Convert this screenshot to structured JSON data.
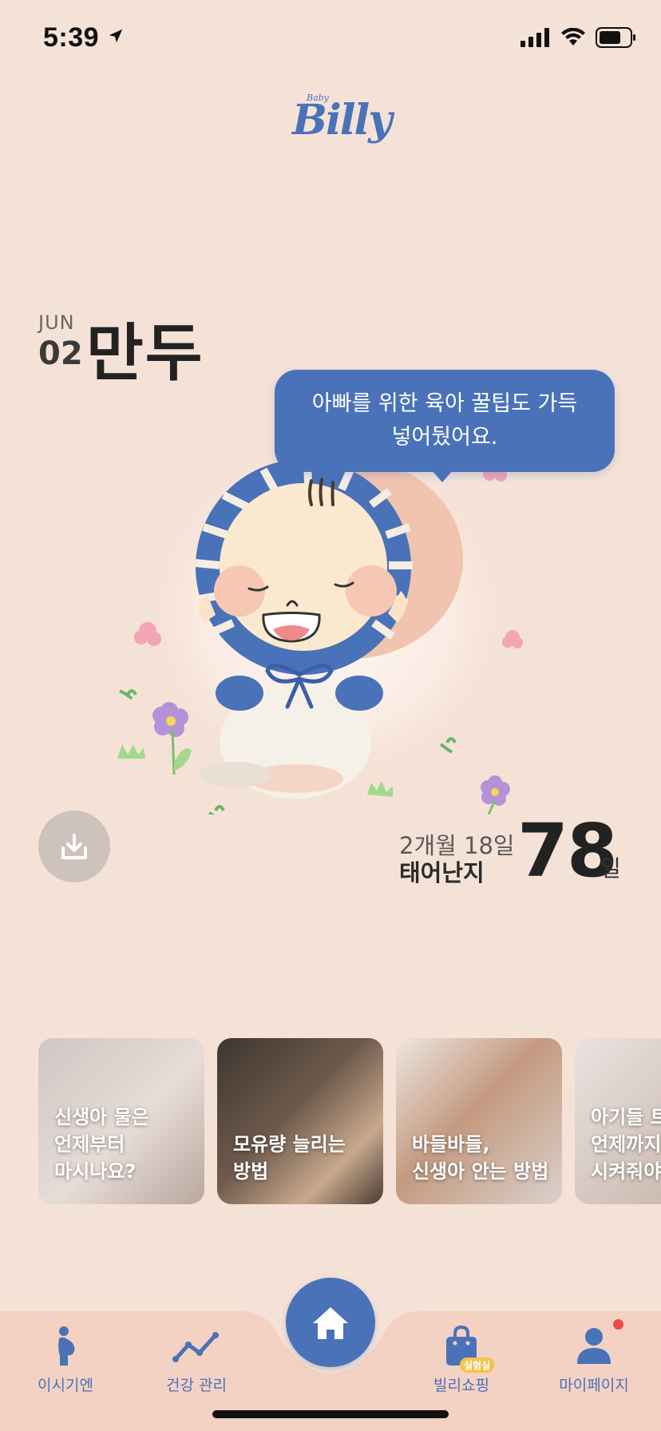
{
  "status_bar": {
    "time": "5:39"
  },
  "brand": {
    "small": "Baby",
    "name": "Billy"
  },
  "baby": {
    "month": "JUN",
    "day": "02",
    "name": "만두"
  },
  "bubble": {
    "line1": "아빠를 위한 육아 꿀팁도 가득",
    "line2": "넣어뒀어요."
  },
  "age": {
    "detail": "2개월 18일",
    "label": "태어난지",
    "days": "78",
    "unit": "일"
  },
  "cards": [
    {
      "line1": "신생아 물은",
      "line2": "언제부터",
      "line3": "마시나요?"
    },
    {
      "line1": "모유량 늘리는",
      "line2": "방법"
    },
    {
      "line1": "바들바들,",
      "line2": "신생아 안는 방법"
    },
    {
      "line1": "아기들 트",
      "line2": "언제까지",
      "line3": "시켜줘야"
    }
  ],
  "tabs": [
    {
      "label": "이시기엔",
      "icon": "pregnant-person-icon"
    },
    {
      "label": "건강 관리",
      "icon": "chart-line-icon"
    },
    {
      "label": "",
      "icon": "home-icon"
    },
    {
      "label": "빌리쇼핑",
      "icon": "shopping-bag-icon",
      "badge": "실험실"
    },
    {
      "label": "마이페이지",
      "icon": "user-icon"
    }
  ],
  "colors": {
    "primary": "#4A72B8",
    "background": "#F5E2D7",
    "tabbar": "#F3D1C3"
  }
}
